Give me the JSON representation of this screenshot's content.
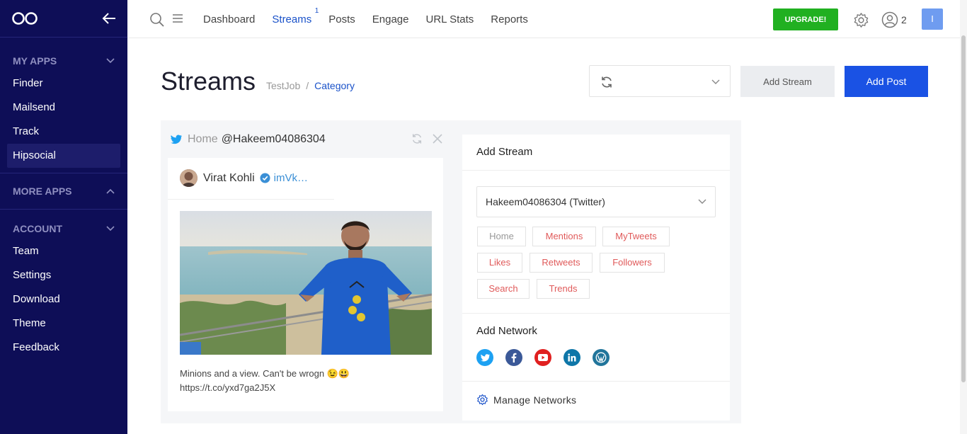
{
  "sidebar": {
    "sections": [
      {
        "title": "MY APPS",
        "items": [
          "Finder",
          "Mailsend",
          "Track",
          "Hipsocial"
        ]
      },
      {
        "title": "MORE APPS",
        "items": []
      },
      {
        "title": "ACCOUNT",
        "items": [
          "Team",
          "Settings",
          "Download",
          "Theme",
          "Feedback"
        ]
      }
    ],
    "active_item": "Hipsocial",
    "colors": {
      "background": "#0e0e57"
    }
  },
  "topbar": {
    "nav": [
      "Dashboard",
      "Streams",
      "Posts",
      "Engage",
      "URL Stats",
      "Reports"
    ],
    "active_nav": "Streams",
    "streams_badge": "1",
    "upgrade_label": "UPGRADE!",
    "user_count": "2",
    "avatar_initial": "I"
  },
  "page": {
    "title": "Streams",
    "breadcrumb": [
      "TestJob",
      "Category"
    ],
    "add_stream_label": "Add Stream",
    "add_post_label": "Add Post",
    "refresh_select_value": ""
  },
  "stream": {
    "home_label": "Home",
    "handle": "@Hakeem04086304",
    "tweet": {
      "user_name": "Virat Kohli",
      "user_handle": "imVk…",
      "text": "Minions and a view. Can't be wrogn 😉😃",
      "link": "https://t.co/yxd7ga2J5X"
    }
  },
  "add_stream_panel": {
    "title": "Add Stream",
    "account": "Hakeem04086304 (Twitter)",
    "chips": [
      "Home",
      "Mentions",
      "MyTweets",
      "Likes",
      "Retweets",
      "Followers",
      "Search",
      "Trends"
    ],
    "network_title": "Add Network",
    "networks": [
      "twitter-icon",
      "facebook-icon",
      "youtube-icon",
      "linkedin-icon",
      "wordpress-icon"
    ],
    "manage_label": "Manage Networks"
  }
}
